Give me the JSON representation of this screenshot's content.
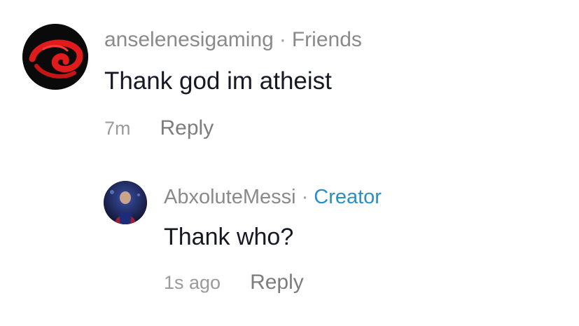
{
  "comments": [
    {
      "username": "anselenesigaming",
      "separator": "·",
      "badge": "Friends",
      "text": "Thank god im atheist",
      "time": "7m",
      "reply_label": "Reply",
      "avatar_colors": {
        "bg": "#0a0a0a",
        "swirl": "#e01b1b"
      }
    },
    {
      "username": "AbxoluteMessi",
      "separator": "·",
      "badge": "Creator",
      "text": "Thank who?",
      "time": "1s ago",
      "reply_label": "Reply",
      "avatar_colors": {
        "bg": "#1b2350",
        "accent": "#b81e3a"
      }
    }
  ],
  "colors": {
    "username": "#8a8a8a",
    "creator_badge": "#2b8fc7",
    "comment_text": "#161823",
    "reply": "#7d7d7d"
  }
}
